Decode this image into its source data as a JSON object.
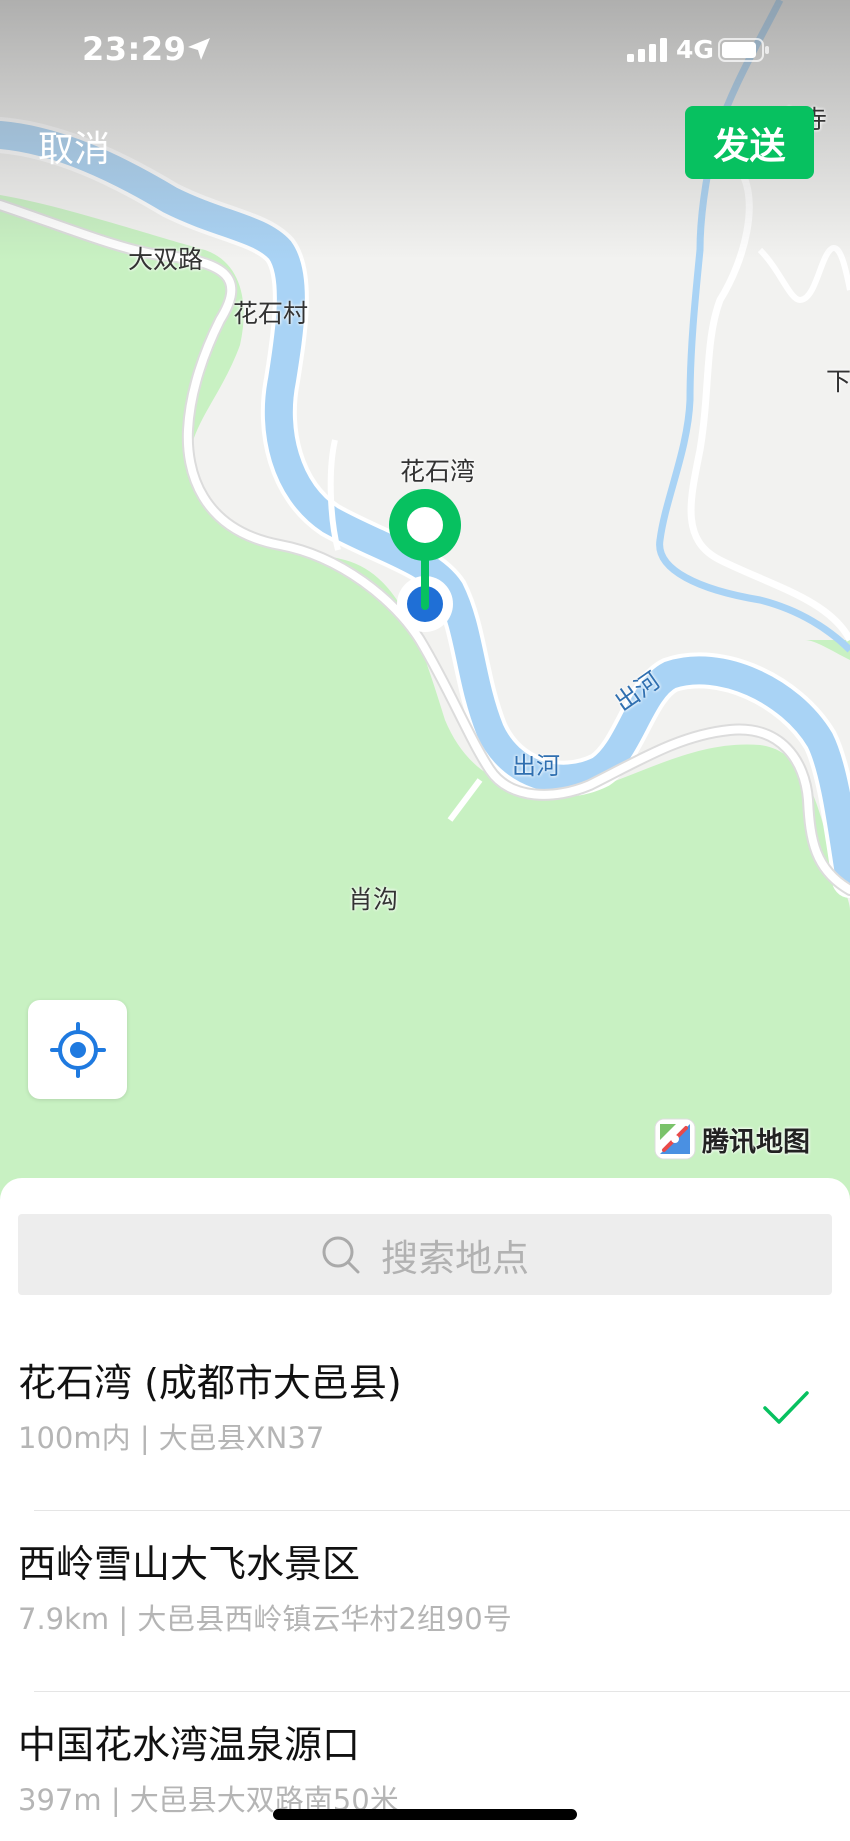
{
  "status_bar": {
    "time": "23:29",
    "network": "4G"
  },
  "header": {
    "cancel_label": "取消",
    "send_label": "发送"
  },
  "map": {
    "labels": {
      "dashuang_road": "大双路",
      "huashi_village": "花石村",
      "huashiwan": "花石湾",
      "chuhe_1": "出河",
      "chuhe_2": "出河",
      "xiaogou": "肖沟",
      "temple_partial": "三宝寺",
      "edge_partial": "下"
    },
    "provider": "腾讯地图",
    "colors": {
      "land": "#f2f2f0",
      "green": "#c8f1c2",
      "river": "#a9d3f5",
      "road": "#ffffff",
      "accent": "#07c160",
      "location_dot": "#1f6fd6"
    }
  },
  "search": {
    "placeholder": "搜索地点"
  },
  "places": [
    {
      "name": "花石湾 (成都市大邑县)",
      "detail": "100m内 | 大邑县XN37",
      "selected": true
    },
    {
      "name": "西岭雪山大飞水景区",
      "detail": "7.9km | 大邑县西岭镇云华村2组90号",
      "selected": false
    },
    {
      "name": "中国花水湾温泉源口",
      "detail": "397m | 大邑县大双路南50米",
      "selected": false
    }
  ]
}
